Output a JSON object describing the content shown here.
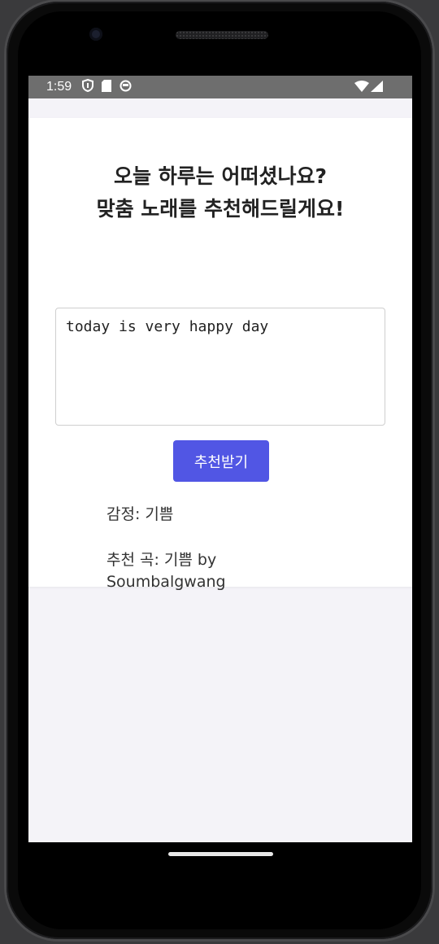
{
  "status_bar": {
    "time": "1:59",
    "left_icons": [
      "shield-icon",
      "sd-card-icon",
      "app-circle-icon"
    ],
    "right_icons": [
      "wifi-icon",
      "cell-signal-icon"
    ]
  },
  "app": {
    "heading_line1": "오늘 하루는 어떠셨나요?",
    "heading_line2": "맞춤 노래를 추천해드릴게요!",
    "input_value": "today is very happy day",
    "recommend_button_label": "추천받기",
    "emotion_text": "감정: 기쁨",
    "song_text": "추천 곡: 기쁨 by Soumbalgwang"
  },
  "colors": {
    "button_bg": "#5156e4",
    "status_bar_bg": "#6e6e6e",
    "screen_bg": "#f4f3f8"
  }
}
